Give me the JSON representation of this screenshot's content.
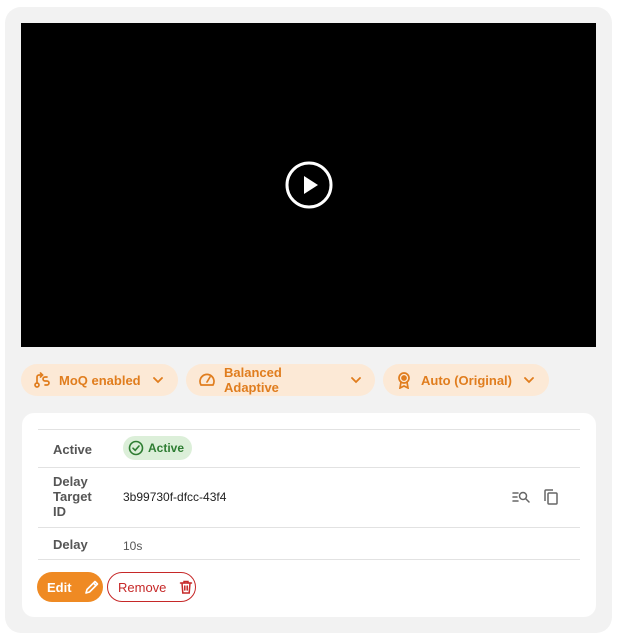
{
  "player": {
    "play_icon": "play-circle-icon"
  },
  "chips": [
    {
      "label": "MoQ enabled",
      "icon": "moq-route-icon"
    },
    {
      "label": "Balanced Adaptive",
      "icon": "speedometer-icon"
    },
    {
      "label": "Auto (Original)",
      "icon": "award-icon"
    }
  ],
  "details": {
    "active_label": "Active",
    "active_value": "Active",
    "delay_target_label": "Delay Target ID",
    "delay_target_value": "3b99730f-dfcc-43f4",
    "delay_label": "Delay",
    "delay_value": "10s"
  },
  "actions": {
    "edit_label": "Edit",
    "remove_label": "Remove"
  },
  "colors": {
    "accent": "#ef8a23",
    "chip_bg": "#fce9d6",
    "success": "#2e7d32",
    "danger": "#c62828"
  }
}
